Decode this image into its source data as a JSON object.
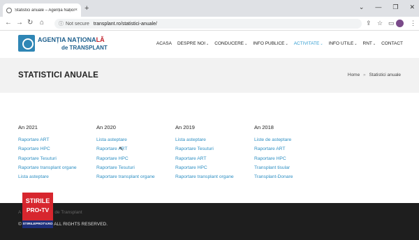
{
  "browser": {
    "tab_title": "Statistici anuale – Agenția Națion...",
    "tab_close": "×",
    "new_tab": "+",
    "window_controls": [
      "⌄",
      "—",
      "❐",
      "✕"
    ],
    "url_warning": "Not secure",
    "url": "transplant.ro/statistici-anuale/"
  },
  "site": {
    "logo_line1_prefix": "AGENȚIA NAȚIONA",
    "logo_line1_suffix": "LĂ",
    "logo_line2": "de TRANSPLANT",
    "nav": [
      {
        "label": "ACASA",
        "chevron": ""
      },
      {
        "label": "DESPRE NOI",
        "chevron": "⌄"
      },
      {
        "label": "CONDUCERE",
        "chevron": "⌄"
      },
      {
        "label": "INFO PUBLICE",
        "chevron": "⌄"
      },
      {
        "label": "ACTIVITATE",
        "chevron": "⌄"
      },
      {
        "label": "INFO UTILE",
        "chevron": "⌄"
      },
      {
        "label": "RNT",
        "chevron": "⌄"
      },
      {
        "label": "CONTACT",
        "chevron": ""
      }
    ],
    "active_nav": "ACTIVITATE",
    "accent_color": "#2e9bd0"
  },
  "page": {
    "title": "STATISTICI ANUALE",
    "breadcrumb": {
      "home": "Home",
      "sep": "»",
      "current": "Statistici anuale"
    }
  },
  "years": [
    {
      "year": "An 2021",
      "links": [
        "Raportare ART",
        "Raportare HPC",
        "Raportare Tesuturi",
        "Raportare transplant organe",
        "Lista asteptare"
      ]
    },
    {
      "year": "An 2020",
      "links": [
        "Lista asteptare",
        "Raportare ART",
        "Raportare HPC",
        "Raportare Tesuturi",
        "Raportare transplant organe"
      ]
    },
    {
      "year": "An 2019",
      "links": [
        "Lista asteptare",
        "Raportare Tesuturi",
        "Raportare ART",
        "Raportare HPC",
        "Raportare transplant organe"
      ]
    },
    {
      "year": "An 2018",
      "links": [
        "Liste de asteptare",
        "Raportare ART",
        "Raportare HPC",
        "Transplant tisular",
        "Transplant-Donare"
      ]
    }
  ],
  "footer": {
    "line1_a": "A",
    "line1_b": "de Transplant",
    "line2_a": "©",
    "line2_b": "22 . ALL RIGHTS RESERVED."
  },
  "watermark": {
    "line1": "STIRILE",
    "line2": "PRO•TV",
    "line3": "STIRILEPROTV.RO"
  }
}
